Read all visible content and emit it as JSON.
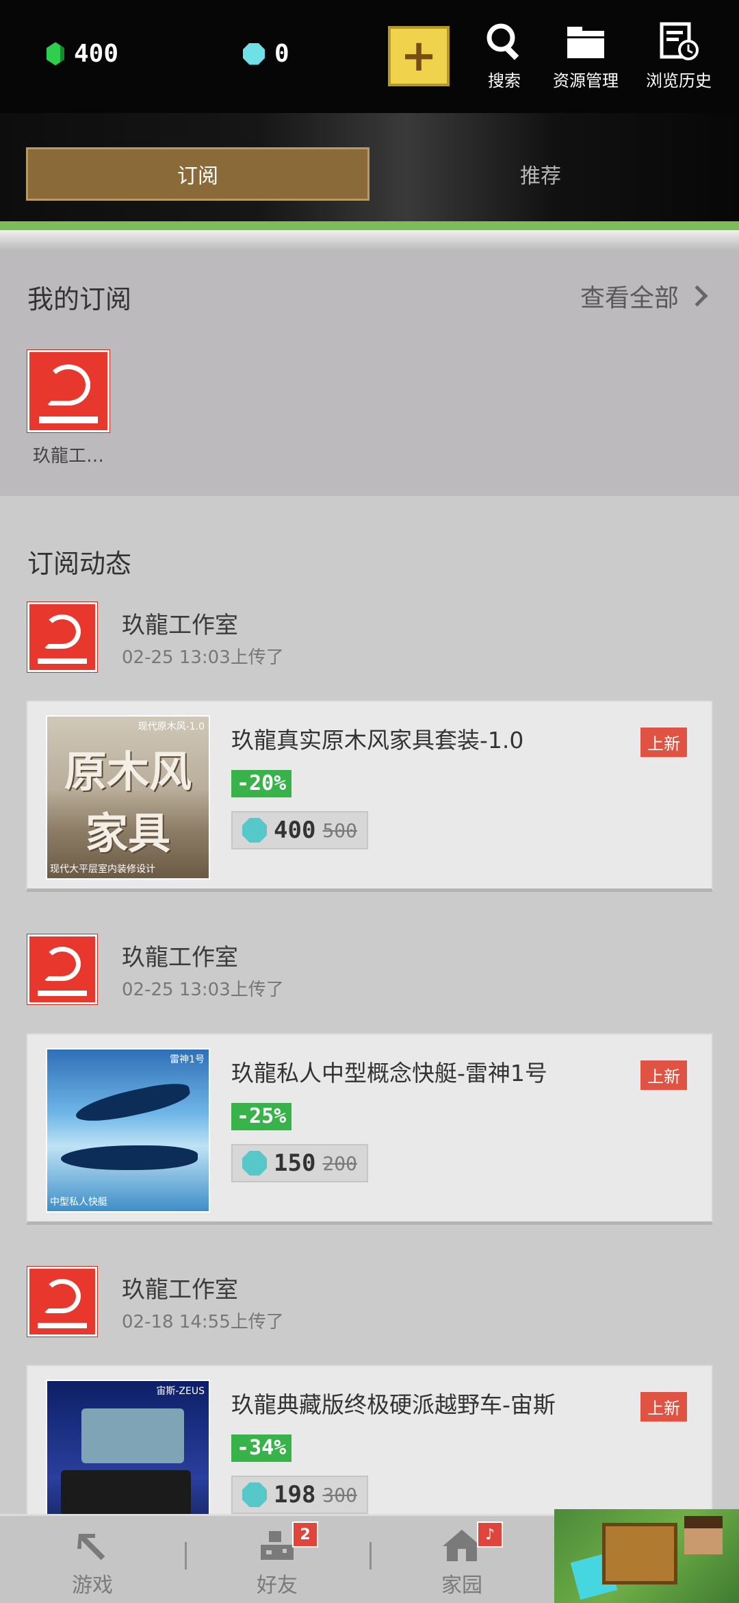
{
  "header": {
    "emerald_count": "400",
    "diamond_count": "0",
    "tools": [
      {
        "label": "搜索",
        "icon": "search-icon"
      },
      {
        "label": "资源管理",
        "icon": "folder-icon"
      },
      {
        "label": "浏览历史",
        "icon": "history-icon"
      }
    ]
  },
  "tabs": {
    "active": "订阅",
    "inactive": "推荐"
  },
  "my_subscriptions": {
    "title": "我的订阅",
    "view_all": "查看全部",
    "items": [
      {
        "label": "玖龍工…"
      }
    ]
  },
  "feed": {
    "title": "订阅动态",
    "posts": [
      {
        "author": "玖龍工作室",
        "time": "02-25 13:03上传了",
        "product": {
          "title": "玖龍真实原木风家具套装-1.0",
          "badge": "上新",
          "discount": "-20%",
          "price": "400",
          "old_price": "500",
          "thumb_text_1": "原木风",
          "thumb_text_2": "家具",
          "thumb_tag": "现代原木风-1.0",
          "thumb_caption": "现代大平层室内装修设计"
        }
      },
      {
        "author": "玖龍工作室",
        "time": "02-25 13:03上传了",
        "product": {
          "title": "玖龍私人中型概念快艇-雷神1号",
          "badge": "上新",
          "discount": "-25%",
          "price": "150",
          "old_price": "200",
          "thumb_tag": "雷神1号",
          "thumb_caption": "中型私人快艇"
        }
      },
      {
        "author": "玖龍工作室",
        "time": "02-18 14:55上传了",
        "product": {
          "title": "玖龍典藏版终极硬派越野车-宙斯",
          "badge": "上新",
          "discount": "-34%",
          "price": "198",
          "old_price": "300",
          "thumb_tag": "宙斯-ZEUS"
        }
      }
    ]
  },
  "bottom_nav": {
    "items": [
      {
        "label": "游戏",
        "icon": "pickaxe-icon"
      },
      {
        "label": "好友",
        "icon": "friends-icon",
        "badge": "2"
      },
      {
        "label": "家园",
        "icon": "home-icon",
        "badge": "♪"
      }
    ]
  },
  "colors": {
    "accent_gold": "#f0d24c",
    "tab_active": "#8a6a39",
    "discount_green": "#37b34a",
    "new_badge_red": "#e05342",
    "progress_green": "#7bbd56"
  }
}
